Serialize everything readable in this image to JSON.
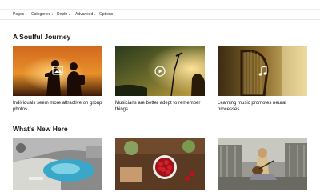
{
  "nav": {
    "items": [
      {
        "label": "Pages",
        "caret": "▾"
      },
      {
        "label": "Categories",
        "caret": "▾"
      },
      {
        "label": "Depth",
        "caret": "▾"
      },
      {
        "label": "Advanced",
        "caret": "▾"
      },
      {
        "label": "Options",
        "caret": ""
      }
    ]
  },
  "section1": {
    "title": "A Soulful Journey",
    "cards": [
      {
        "caption": "Individuals seem more attractive on group photos",
        "icon": "image-icon"
      },
      {
        "caption": "Musicians are better adept to remember things",
        "icon": "play-icon"
      },
      {
        "caption": "Learning music promotes neural processes",
        "icon": "music-note-icon"
      }
    ]
  },
  "section2": {
    "title": "What's New Here"
  }
}
